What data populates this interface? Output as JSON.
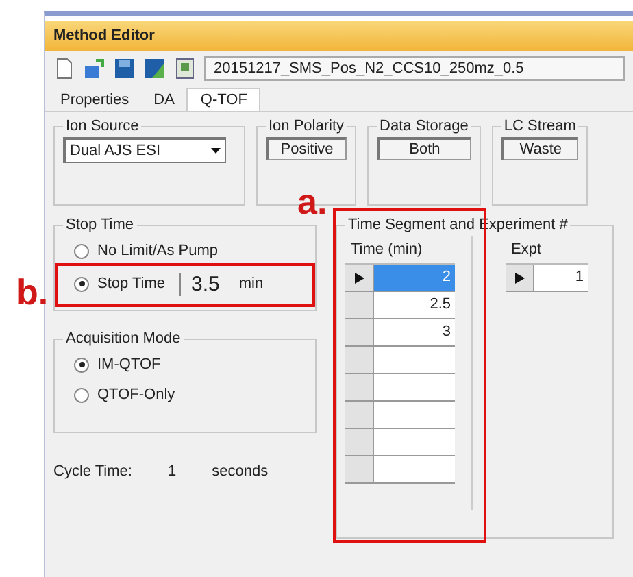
{
  "window": {
    "title": "Method Editor"
  },
  "toolbar": {
    "method_file": "20151217_SMS_Pos_N2_CCS10_250mz_0.5"
  },
  "tabs": [
    {
      "label": "Properties",
      "selected": false
    },
    {
      "label": "DA",
      "selected": false
    },
    {
      "label": "Q-TOF",
      "selected": true
    }
  ],
  "ion_source": {
    "label": "Ion Source",
    "value": "Dual AJS ESI"
  },
  "readouts": [
    {
      "label": "Ion Polarity",
      "value": "Positive"
    },
    {
      "label": "Data Storage",
      "value": "Both"
    },
    {
      "label": "LC Stream",
      "value": "Waste"
    }
  ],
  "stop_time": {
    "label": "Stop Time",
    "options": [
      {
        "label": "No Limit/As Pump",
        "selected": false
      },
      {
        "label": "Stop Time",
        "selected": true
      }
    ],
    "value": "3.5",
    "unit": "min"
  },
  "acquisition_mode": {
    "label": "Acquisition Mode",
    "options": [
      {
        "label": "IM-QTOF",
        "selected": true
      },
      {
        "label": "QTOF-Only",
        "selected": false
      }
    ]
  },
  "cycle_time": {
    "label": "Cycle Time:",
    "value": "1",
    "unit": "seconds"
  },
  "time_segments": {
    "label": "Time Segment and Experiment #",
    "time_column": "Time (min)",
    "expt_column": "Expt",
    "rows": [
      {
        "value": "2",
        "selected": true
      },
      {
        "value": "2.5",
        "selected": false
      },
      {
        "value": "3",
        "selected": false
      }
    ],
    "expt_rows": [
      {
        "value": "1",
        "selected": true
      }
    ]
  },
  "annotations": [
    {
      "label": "a."
    },
    {
      "label": "b."
    }
  ]
}
